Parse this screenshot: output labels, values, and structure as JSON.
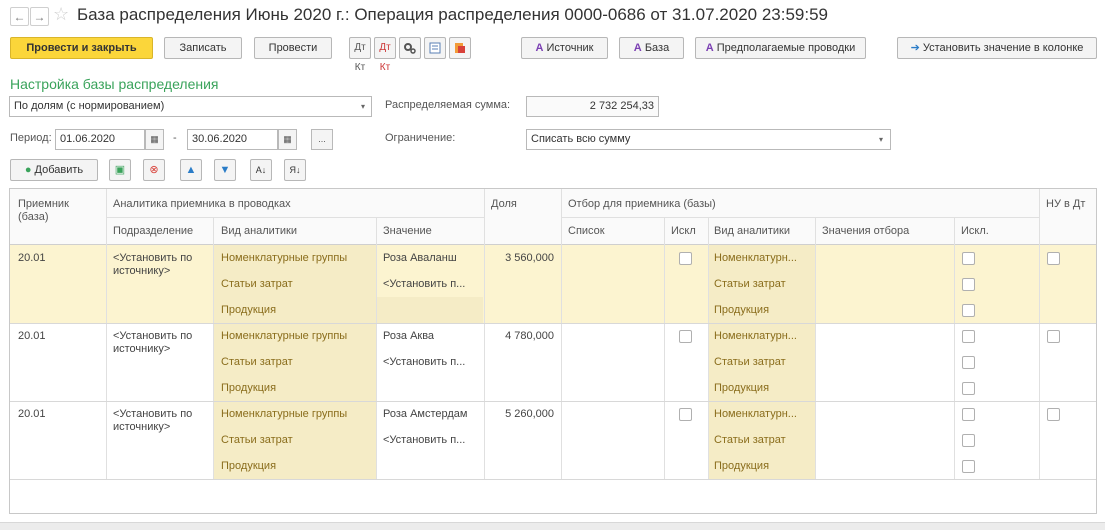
{
  "window": {
    "title": "База распределения Июнь 2020 г.: Операция распределения 0000-0686 от 31.07.2020 23:59:59",
    "back_icon": "←",
    "forward_icon": "→",
    "star_icon": "☆"
  },
  "toolbar": {
    "post_close": "Провести и закрыть",
    "save": "Записать",
    "post": "Провести",
    "dt_kt_1": "Дт Кт",
    "dt_kt_2": "Дт Кт",
    "source": "Источник",
    "base": "База",
    "expected_entries": "Предполагаемые проводки",
    "set_value_column": "Установить значение в колонке"
  },
  "settings": {
    "section_title": "Настройка базы распределения",
    "method": "По долям (с нормированием)",
    "distributed_sum_label": "Распределяемая сумма:",
    "distributed_sum": "2 732 254,33",
    "period_label": "Период:",
    "period_from": "01.06.2020",
    "period_dash": "-",
    "period_to": "30.06.2020",
    "ellipsis": "...",
    "limit_label": "Ограничение:",
    "limit_value": "Списать всю сумму"
  },
  "table_toolbar": {
    "add": "Добавить",
    "sort_az": "А↓",
    "sort_za": "Я↓"
  },
  "table": {
    "headers": {
      "receiver": "Приемник (база)",
      "analytics_group": "Аналитика приемника  в проводках",
      "department": "Подразделение",
      "analytic_type": "Вид аналитики",
      "value": "Значение",
      "share": "Доля",
      "filter_group": "Отбор для приемника (базы)",
      "list": "Список",
      "excl": "Искл",
      "filter_type": "Вид аналитики",
      "filter_values": "Значения отбора",
      "excl2": "Искл.",
      "nu_dt": "НУ в Дт"
    },
    "rows": [
      {
        "receiver": "20.01",
        "department": "<Установить по источнику>",
        "types": [
          "Номенклатурные группы",
          "Статьи затрат",
          "Продукция"
        ],
        "values": [
          "Роза Аваланш",
          "<Установить п...",
          ""
        ],
        "share": "3 560,000",
        "filter_types": [
          "Номенклатурн...",
          "Статьи затрат",
          "Продукция"
        ]
      },
      {
        "receiver": "20.01",
        "department": "<Установить по источнику>",
        "types": [
          "Номенклатурные группы",
          "Статьи затрат",
          "Продукция"
        ],
        "values": [
          "Роза Аква",
          "<Установить п...",
          ""
        ],
        "share": "4 780,000",
        "filter_types": [
          "Номенклатурн...",
          "Статьи затрат",
          "Продукция"
        ]
      },
      {
        "receiver": "20.01",
        "department": "<Установить по источнику>",
        "types": [
          "Номенклатурные группы",
          "Статьи затрат",
          "Продукция"
        ],
        "values": [
          "Роза Амстердам",
          "<Установить п...",
          ""
        ],
        "share": "5 260,000",
        "filter_types": [
          "Номенклатурн...",
          "Статьи затрат",
          "Продукция"
        ]
      }
    ]
  },
  "colors": {
    "primary_button": "#fbd63a",
    "section_title": "#3aa35b",
    "selected_row": "#fcf4d0",
    "analytic_cell": "#f5ecc6"
  }
}
